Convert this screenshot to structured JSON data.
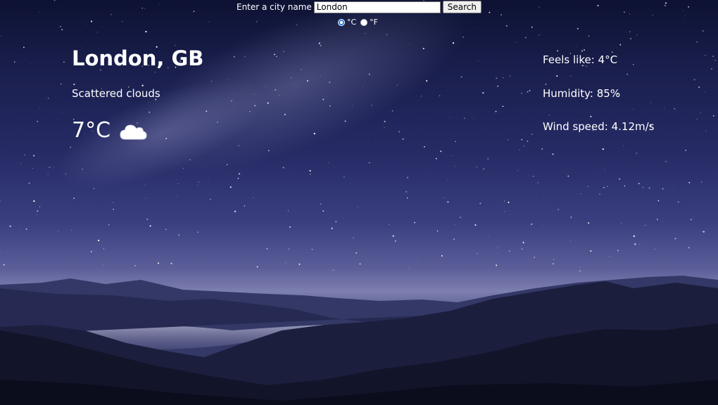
{
  "search": {
    "label": "Enter a city name",
    "value": "London",
    "button_label": "Search"
  },
  "units": {
    "options": [
      "°C",
      "°F"
    ],
    "selected": "°C"
  },
  "weather": {
    "city": "London, GB",
    "description": "Scattered clouds",
    "temperature": "7°C",
    "icon": "cloud-icon",
    "feels_like": "Feels like: 4°C",
    "humidity": "Humidity: 85%",
    "wind_speed": "Wind speed: 4.12m/s"
  },
  "colors": {
    "sky_top": "#0d1233",
    "sky_mid": "#262b66",
    "horizon": "#7d7fb0",
    "mountains_dark": "#15172f",
    "radio_accent": "#1a73e8"
  }
}
